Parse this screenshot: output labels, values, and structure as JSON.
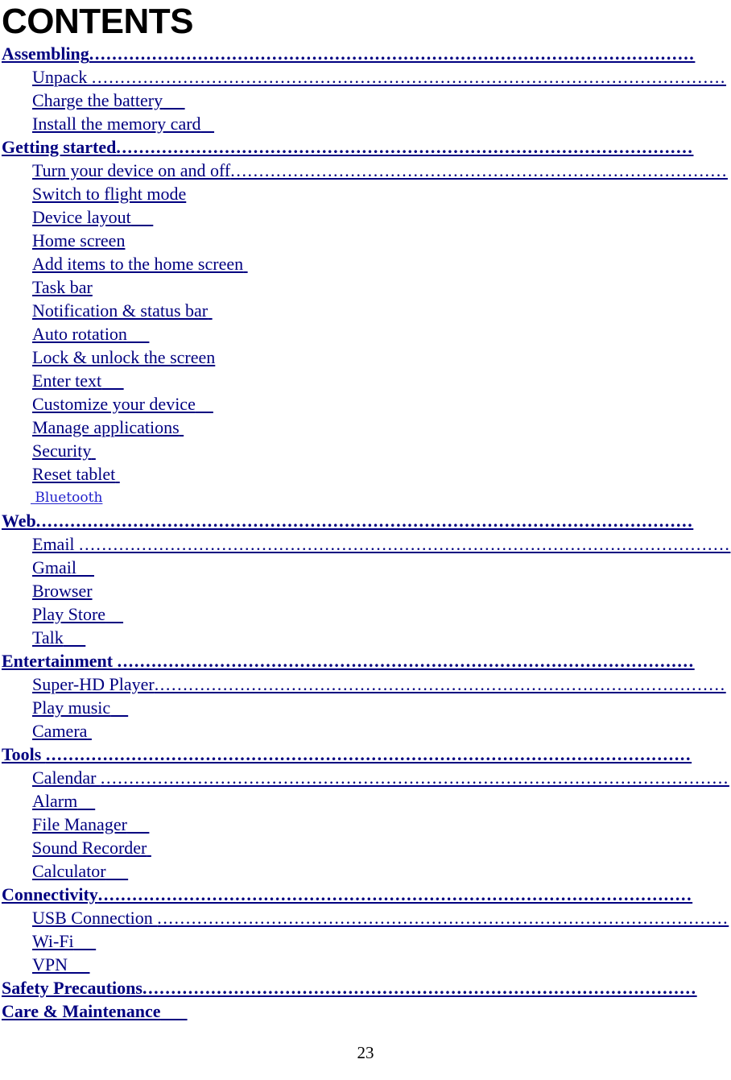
{
  "page": {
    "heading": "CONTENTS",
    "page_number": "23",
    "text_color": "#000080",
    "heading_color": "#000000",
    "accent_alt_color": "#2222CC"
  },
  "toc": {
    "entries": [
      {
        "level": 1,
        "label": "Assembling",
        "leader": true,
        "tail": ""
      },
      {
        "level": 2,
        "label": "Unpack ",
        "leader": true,
        "tail": ""
      },
      {
        "level": 2,
        "label": "Charge the battery",
        "leader": false,
        "tail": "     "
      },
      {
        "level": 2,
        "label": "Install the memory card",
        "leader": false,
        "tail": "   "
      },
      {
        "level": 1,
        "label": "Getting started",
        "leader": true,
        "tail": ""
      },
      {
        "level": 2,
        "label": "Turn your device on and off",
        "leader": true,
        "tail": ""
      },
      {
        "level": 2,
        "label": "Switch to flight mode",
        "leader": false,
        "tail": ""
      },
      {
        "level": 2,
        "label": "Device layout",
        "leader": false,
        "tail": "     "
      },
      {
        "level": 2,
        "label": "Home screen",
        "leader": false,
        "tail": ""
      },
      {
        "level": 2,
        "label": "Add items to the home screen",
        "leader": false,
        "tail": " "
      },
      {
        "level": 2,
        "label": "Task bar",
        "leader": false,
        "tail": ""
      },
      {
        "level": 2,
        "label": "Notification & status bar",
        "leader": false,
        "tail": " "
      },
      {
        "level": 2,
        "label": "Auto rotation",
        "leader": false,
        "tail": "     "
      },
      {
        "level": 2,
        "label": "Lock & unlock the screen",
        "leader": false,
        "tail": ""
      },
      {
        "level": 2,
        "label": "Enter text",
        "leader": false,
        "tail": "     "
      },
      {
        "level": 2,
        "label": "Customize your device",
        "leader": false,
        "tail": "    "
      },
      {
        "level": 2,
        "label": "Manage applications",
        "leader": false,
        "tail": " "
      },
      {
        "level": 2,
        "label": "Security",
        "leader": false,
        "tail": " "
      },
      {
        "level": 2,
        "label": "Reset tablet",
        "leader": false,
        "tail": " "
      },
      {
        "level": 2,
        "label": " Bluetooth",
        "leader": false,
        "tail": "",
        "variant": "small"
      },
      {
        "level": 1,
        "label": "Web",
        "leader": true,
        "tail": ""
      },
      {
        "level": 2,
        "label": "Email ",
        "leader": true,
        "tail": ""
      },
      {
        "level": 2,
        "label": "Gmail",
        "leader": false,
        "tail": "    "
      },
      {
        "level": 2,
        "label": "Browser",
        "leader": false,
        "tail": ""
      },
      {
        "level": 2,
        "label": "Play Store",
        "leader": false,
        "tail": "    "
      },
      {
        "level": 2,
        "label": "Talk",
        "leader": false,
        "tail": "     "
      },
      {
        "level": 1,
        "label": "Entertainment ",
        "leader": true,
        "tail": ""
      },
      {
        "level": 2,
        "label": "Super-HD Player",
        "leader": true,
        "tail": ""
      },
      {
        "level": 2,
        "label": "Play music",
        "leader": false,
        "tail": "    "
      },
      {
        "level": 2,
        "label": "Camera",
        "leader": false,
        "tail": " "
      },
      {
        "level": 1,
        "label": "Tools ",
        "leader": true,
        "tail": ""
      },
      {
        "level": 2,
        "label": "Calendar ",
        "leader": true,
        "tail": ""
      },
      {
        "level": 2,
        "label": "Alarm",
        "leader": false,
        "tail": "    "
      },
      {
        "level": 2,
        "label": "File Manager",
        "leader": false,
        "tail": "     "
      },
      {
        "level": 2,
        "label": "Sound Recorder",
        "leader": false,
        "tail": " "
      },
      {
        "level": 2,
        "label": "Calculator",
        "leader": false,
        "tail": "     "
      },
      {
        "level": 1,
        "label": "Connectivity",
        "leader": true,
        "tail": ""
      },
      {
        "level": 2,
        "label": "USB Connection ",
        "leader": true,
        "tail": ""
      },
      {
        "level": 2,
        "label": "Wi-Fi",
        "leader": false,
        "tail": "     "
      },
      {
        "level": 2,
        "label": "VPN",
        "leader": false,
        "tail": "     "
      },
      {
        "level": 1,
        "label": "Safety Precautions",
        "leader": true,
        "tail": ""
      },
      {
        "level": 1,
        "label": "Care & Maintenance",
        "leader": false,
        "tail": "      "
      }
    ]
  }
}
